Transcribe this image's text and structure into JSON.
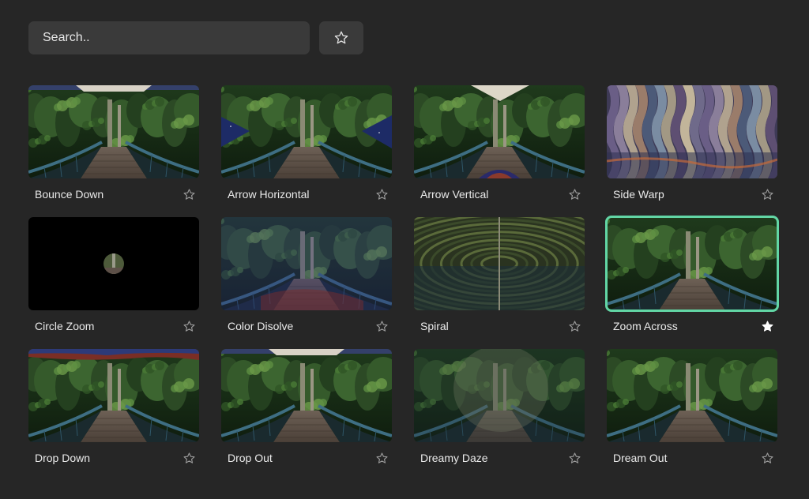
{
  "search": {
    "placeholder": "Search.."
  },
  "favorites_filter": {
    "icon": "star-outline-icon"
  },
  "accent_color": "#62d6a5",
  "transitions": [
    {
      "id": "bounce-down",
      "label": "Bounce Down",
      "favorite": false,
      "selected": false,
      "preview": "bridge",
      "overlay": "top-bar-light"
    },
    {
      "id": "arrow-horizontal",
      "label": "Arrow Horizontal",
      "favorite": false,
      "selected": false,
      "preview": "bridge",
      "overlay": "side-arrows"
    },
    {
      "id": "arrow-vertical",
      "label": "Arrow Vertical",
      "favorite": false,
      "selected": false,
      "preview": "bridge",
      "overlay": "vertical-arrows"
    },
    {
      "id": "side-warp",
      "label": "Side Warp",
      "favorite": false,
      "selected": false,
      "preview": "warp",
      "overlay": "none"
    },
    {
      "id": "circle-zoom",
      "label": "Circle Zoom",
      "favorite": false,
      "selected": false,
      "preview": "black-circle",
      "overlay": "none"
    },
    {
      "id": "color-disolve",
      "label": "Color Disolve",
      "favorite": false,
      "selected": false,
      "preview": "bridge",
      "overlay": "color-tint"
    },
    {
      "id": "spiral",
      "label": "Spiral",
      "favorite": false,
      "selected": false,
      "preview": "spiral",
      "overlay": "none"
    },
    {
      "id": "zoom-across",
      "label": "Zoom Across",
      "favorite": true,
      "selected": true,
      "preview": "bridge",
      "overlay": "none"
    },
    {
      "id": "drop-down",
      "label": "Drop Down",
      "favorite": false,
      "selected": false,
      "preview": "bridge",
      "overlay": "top-bar-color"
    },
    {
      "id": "drop-out",
      "label": "Drop Out",
      "favorite": false,
      "selected": false,
      "preview": "bridge",
      "overlay": "top-bar-light"
    },
    {
      "id": "dreamy-daze",
      "label": "Dreamy Daze",
      "favorite": false,
      "selected": false,
      "preview": "bridge",
      "overlay": "haze"
    },
    {
      "id": "dream-out",
      "label": "Dream Out",
      "favorite": false,
      "selected": false,
      "preview": "bridge",
      "overlay": "none"
    }
  ]
}
